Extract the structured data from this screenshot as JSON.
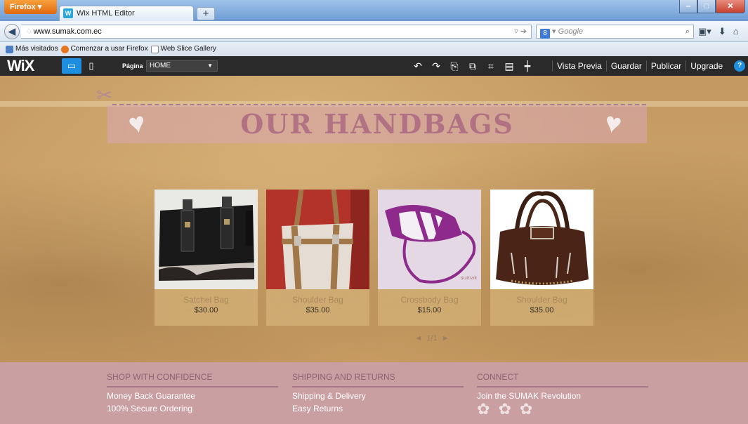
{
  "browser": {
    "menu_button": "Firefox",
    "tab_title": "Wix HTML Editor",
    "tab_favicon": "W",
    "new_tab": "+",
    "url": "www.sumak.com.ec",
    "search_placeholder": "Google",
    "search_engine_icon": "8",
    "bookmarks": [
      {
        "label": "Más visitados",
        "icon": "folder-icon",
        "color": "#4d7fc4"
      },
      {
        "label": "Comenzar a usar Firefox",
        "icon": "firefox-icon",
        "color": "#e6761c"
      },
      {
        "label": "Web Slice Gallery",
        "icon": "web-slice-icon",
        "color": "#ffffff"
      }
    ]
  },
  "editor": {
    "logo": "WiX",
    "page_label": "Página",
    "page_value": "HOME",
    "actions": [
      "Vista Previa",
      "Guardar",
      "Publicar",
      "Upgrade"
    ],
    "help": "?"
  },
  "site": {
    "banner_title": "OUR HANDBAGS",
    "products": [
      {
        "name": "Satchel Bag",
        "price": "$30.00"
      },
      {
        "name": "Shoulder Bag",
        "price": "$35.00"
      },
      {
        "name": "Crossbody Bag",
        "price": "$15.00"
      },
      {
        "name": "Shoulder Bag",
        "price": "$35.00"
      }
    ],
    "pager": {
      "prev": "◄",
      "page": "1/1",
      "next": "►"
    },
    "footer": {
      "col1": {
        "heading": "SHOP WITH CONFIDENCE",
        "items": [
          "Money Back Guarantee",
          "100% Secure Ordering"
        ]
      },
      "col2": {
        "heading": "SHIPPING AND RETURNS",
        "items": [
          "Shipping & Delivery",
          "Easy Returns"
        ]
      },
      "col3": {
        "heading": "CONNECT",
        "items": [
          "Join the SUMAK Revolution"
        ]
      }
    }
  },
  "colors": {
    "wix_bar": "#2a2a2a",
    "wix_accent": "#1e8fe0",
    "canvas": "#c9a36a",
    "banner": "#d8a6b4",
    "footer": "#c99fa2"
  }
}
